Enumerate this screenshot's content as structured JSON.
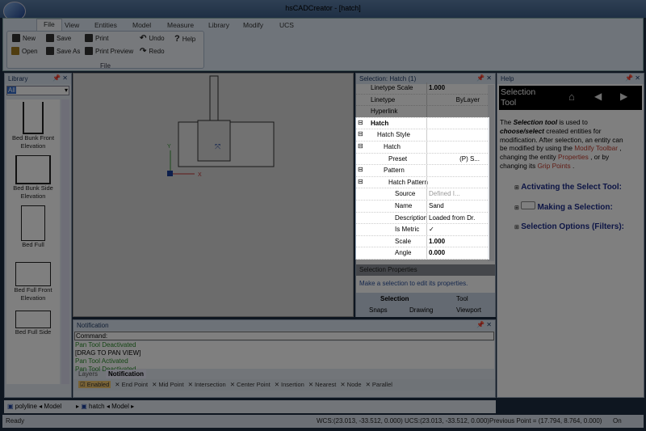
{
  "window": {
    "title": "hsCADCreator - [hatch]"
  },
  "menu": {
    "tabs": [
      "File",
      "View",
      "Entities",
      "Model",
      "Measure",
      "Library",
      "Modify",
      "UCS"
    ]
  },
  "ribbon": {
    "group_label": "File",
    "buttons": {
      "new": "New",
      "open": "Open",
      "save": "Save",
      "save_as": "Save As",
      "print": "Print",
      "print_preview": "Print Preview",
      "undo": "Undo",
      "redo": "Redo",
      "help": "Help"
    }
  },
  "library": {
    "title": "Library",
    "filter": "All",
    "items": [
      "Bed Bunk Front Elevation",
      "Bed Bunk Side Elevation",
      "Bed Full",
      "Bed Full Front Elevation",
      "Bed Full Side"
    ]
  },
  "properties": {
    "title": "Selection: Hatch (1)",
    "rows": [
      {
        "name": "Linetype Scale",
        "value": "1.000"
      },
      {
        "name": "Linetype",
        "value": "ByLayer"
      },
      {
        "name": "Hyperlink",
        "value": ""
      },
      {
        "name": "Hatch",
        "value": ""
      },
      {
        "name": "Hatch Style",
        "value": ""
      },
      {
        "name": "Hatch",
        "value": ""
      },
      {
        "name": "Preset",
        "value": "(P) S..."
      },
      {
        "name": "Pattern",
        "value": ""
      },
      {
        "name": "Hatch Pattern",
        "value": ""
      },
      {
        "name": "Source",
        "value": "Defined I..."
      },
      {
        "name": "Name",
        "value": "Sand"
      },
      {
        "name": "Description",
        "value": "Loaded from Dr."
      },
      {
        "name": "Is Metric",
        "value": "✓"
      },
      {
        "name": "Scale",
        "value": "1.000"
      },
      {
        "name": "Angle",
        "value": "0.000"
      }
    ],
    "section_title": "Selection Properties",
    "hint": "Make a selection to edit its properties.",
    "tabs_top": [
      "Selection",
      "Tool"
    ],
    "tabs_bottom": [
      "Snaps",
      "Drawing",
      "Viewport"
    ]
  },
  "help": {
    "title": "Help",
    "heading": "Selection Tool",
    "p_the": "The ",
    "p_tool": "Selection tool",
    "p_used": " is used to ",
    "p_choose": "choose/select",
    "p_rest": " created entities for modification. After selection, an entity can be modified by using the ",
    "link1": "Modify Toolbar",
    "p2": " , changing the entity ",
    "link2": "Properties",
    "p3": " , or by changing its ",
    "link3": "Grip Points",
    "p4": " .",
    "sections": [
      "Activating the Select Tool:",
      "Making a Selection:",
      "Selection Options (Filters):"
    ]
  },
  "notification": {
    "title": "Notification",
    "command_label": "Command:",
    "log": [
      {
        "text": "Pan Tool Deactivated",
        "color": "green"
      },
      {
        "text": "[DRAG TO PAN VIEW]",
        "color": "black"
      },
      {
        "text": "Pan Tool Activated",
        "color": "green"
      },
      {
        "text": "Pan Tool Deactivated",
        "color": "green"
      }
    ],
    "tabs": [
      "Layers",
      "Notification"
    ],
    "snaps": [
      "Enabled",
      "End Point",
      "Mid Point",
      "Intersection",
      "Center Point",
      "Insertion",
      "Nearest",
      "Node",
      "Parallel"
    ]
  },
  "doc_tabs": [
    {
      "name": "polyline",
      "space": "Model"
    },
    {
      "name": "hatch",
      "space": "Model"
    }
  ],
  "status": {
    "ready": "Ready",
    "wcs": "WCS:(23.013, -33.512, 0.000)",
    "ucs": "UCS:(23.013, -33.512, 0.000)",
    "previous": "Previous Point = (17.794, 8.764, 0.000)",
    "on": "On"
  },
  "canvas": {
    "axis_x": "X",
    "axis_y": "Y"
  }
}
